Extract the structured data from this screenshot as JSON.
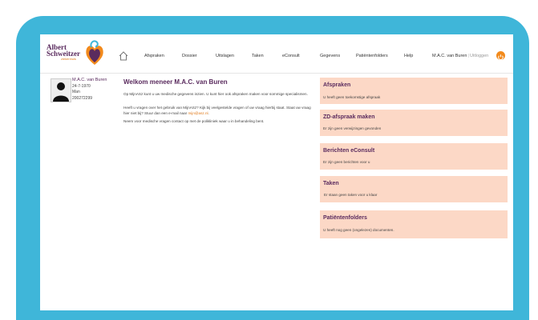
{
  "logo": {
    "line1": "Albert",
    "line2": "Schweitzer",
    "sub": "ziekenhuis"
  },
  "nav": [
    "Afspraken",
    "Dossier",
    "Uitslagen",
    "Taken",
    "eConsult",
    "Gegevens",
    "Patiëntenfolders",
    "Help"
  ],
  "user": {
    "name": "M.A.C. van Buren",
    "separator": "|",
    "logout": "Uitloggen"
  },
  "patient": {
    "name": "M.A.C. van Buren",
    "dob": "24-7-1970",
    "gender": "Man",
    "number": "200272299"
  },
  "welcome": {
    "title": "Welkom meneer M.A.C. van Buren",
    "p1": "Op MijnASz kunt u uw medische gegevens inzien. U kunt hier ook afspraken maken voor sommige specialismen.",
    "p2_before": "Heeft u vragen over het gebruik van MijnASz? Kijk bij veelgestelde vragen of uw vraag hierbij staat. Staat uw vraag hier niet bij? Stuur dan een e-mail naar ",
    "p2_link": "mijn@asz.nl",
    "p2_after": ".",
    "p3": "Neem voor medische vragen contact op met de polikliniek waar u in behandeling bent."
  },
  "cards": [
    {
      "title": "Afspraken",
      "text": "U heeft geen toekomstige afspraak"
    },
    {
      "title": "ZD-afspraak maken",
      "text": "Er zijn geen verwijzingen gevonden"
    },
    {
      "title": "Berichten eConsult",
      "text": "Er zijn geen berichten voor u"
    },
    {
      "title": "Taken",
      "text": "Er staan geen taken voor u klaar"
    },
    {
      "title": "Patiëntenfolders",
      "text": "U heeft nog geen (ongelezen) documenten."
    }
  ],
  "colors": {
    "frame": "#3fb6d9",
    "accent": "#f28a1c",
    "brand": "#5a2b5e",
    "card": "#fcd8c6"
  }
}
